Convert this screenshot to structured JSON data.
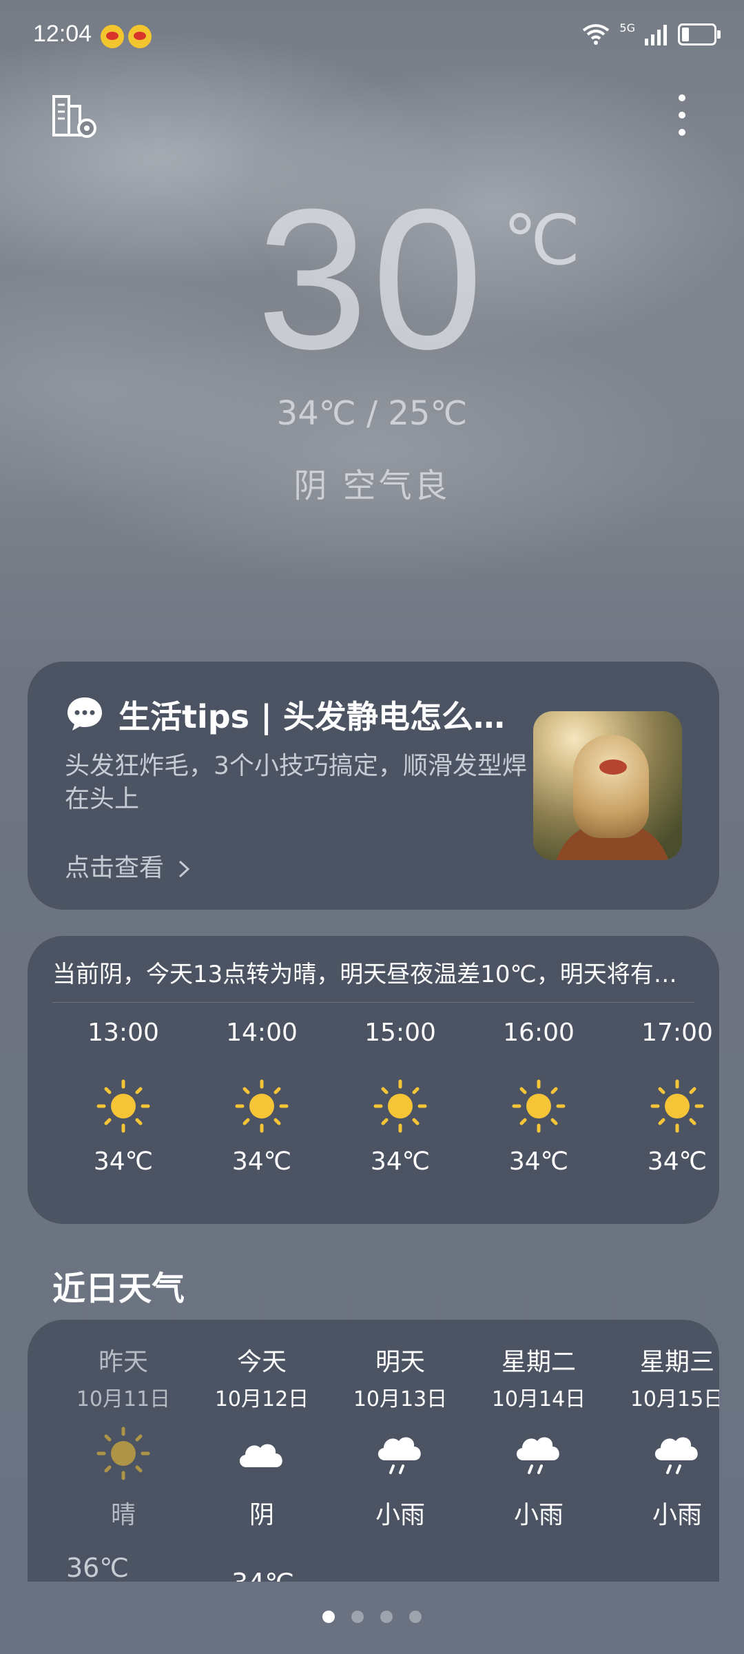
{
  "status_bar": {
    "time": "12:04",
    "network": "5G"
  },
  "current": {
    "temperature": "30",
    "unit": "℃",
    "high_low": "34℃ / 25℃",
    "condition": "阴  空气良"
  },
  "tips": {
    "title": "生活tips | 头发静电怎么…",
    "description": "头发狂炸毛，3个小技巧搞定，顺滑发型焊在头上",
    "link": "点击查看"
  },
  "hourly": {
    "summary": "当前阴，今天13点转为晴，明天昼夜温差10℃，明天将有…",
    "items": [
      {
        "time": "13:00",
        "icon": "sun-icon",
        "temp": "34℃"
      },
      {
        "time": "14:00",
        "icon": "sun-icon",
        "temp": "34℃"
      },
      {
        "time": "15:00",
        "icon": "sun-icon",
        "temp": "34℃"
      },
      {
        "time": "16:00",
        "icon": "sun-icon",
        "temp": "34℃"
      },
      {
        "time": "17:00",
        "icon": "sun-icon",
        "temp": "34℃"
      }
    ]
  },
  "daily": {
    "title": "近日天气",
    "items": [
      {
        "day": "昨天",
        "date": "10月11日",
        "icon": "sun-icon",
        "condition": "晴",
        "high": "36℃"
      },
      {
        "day": "今天",
        "date": "10月12日",
        "icon": "cloud-icon",
        "condition": "阴",
        "high": "34℃"
      },
      {
        "day": "明天",
        "date": "10月13日",
        "icon": "rain-icon",
        "condition": "小雨"
      },
      {
        "day": "星期二",
        "date": "10月14日",
        "icon": "rain-icon",
        "condition": "小雨"
      },
      {
        "day": "星期三",
        "date": "10月15日",
        "icon": "rain-icon",
        "condition": "小雨"
      }
    ]
  },
  "pager": {
    "count": 4,
    "active": 0
  },
  "colors": {
    "card": "#4c5463",
    "sun": "#f6c437",
    "background": "#6b7382"
  }
}
